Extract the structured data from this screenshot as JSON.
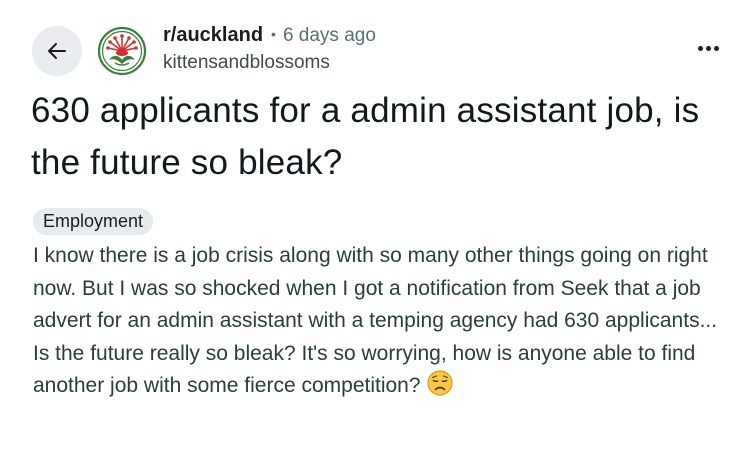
{
  "header": {
    "subreddit": "r/auckland",
    "separator": "•",
    "time_ago": "6 days ago",
    "username": "kittensandblossoms"
  },
  "icons": {
    "back": "arrow-left-icon",
    "avatar": "subreddit-avatar-pohutukawa",
    "more": "more-options-icon",
    "emoji": "disappointed-face-emoji"
  },
  "post": {
    "title": "630 applicants for a admin assistant job, is the future so bleak?",
    "flair": "Employment",
    "body": "I know there is a job crisis along with so many other things going on right now. But I was so shocked when I got a notification from Seek that a job advert for an admin assistant with a temping agency had 630 applicants... Is the future really so bleak? It's so worrying, how is anyone able to find another job with some fierce competition?"
  },
  "colors": {
    "avatar_green": "#3b7d3a",
    "avatar_red": "#d62e2e",
    "button_bg": "#eaedef",
    "flair_bg": "#e5ebee",
    "meta_gray": "#576f76"
  }
}
